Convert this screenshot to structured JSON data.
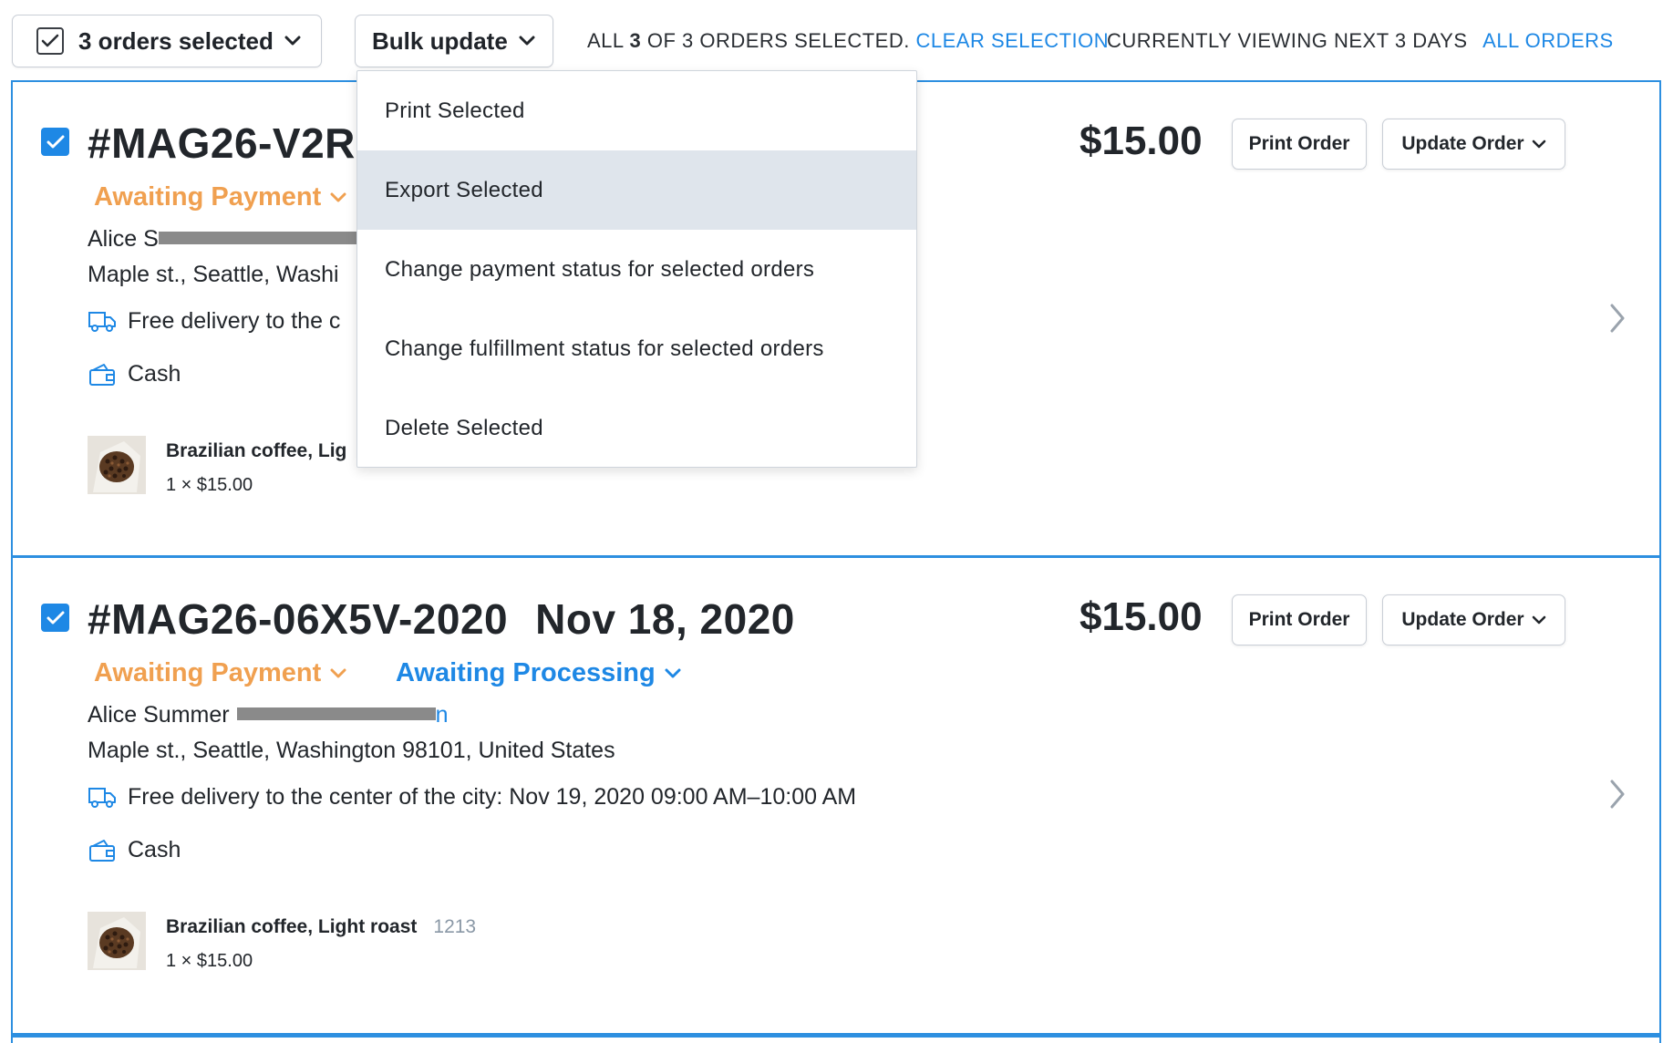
{
  "toolbar": {
    "selected_label": "3 orders selected",
    "bulk_label": "Bulk update",
    "sel_prefix": "ALL",
    "sel_count": "3",
    "sel_suffix": "OF 3 ORDERS SELECTED.",
    "clear_selection": "CLEAR SELECTION",
    "viewing": "CURRENTLY VIEWING NEXT 3 DAYS",
    "all_orders": "ALL ORDERS"
  },
  "dropdown": {
    "items": [
      {
        "label": "Print Selected"
      },
      {
        "label": "Export Selected"
      },
      {
        "label": "Change payment status for selected orders"
      },
      {
        "label": "Change fulfillment status for selected orders"
      },
      {
        "label": "Delete Selected"
      }
    ],
    "highlighted_index": 1
  },
  "orders": [
    {
      "number": "#MAG26-V2R",
      "date": "",
      "payment_status": "Awaiting Payment",
      "fulfillment_status": "",
      "customer": "Alice S",
      "email_tail": "",
      "address": "Maple st., Seattle, Washi",
      "delivery": "Free delivery to the c",
      "payment_method": "Cash",
      "product_name": "Brazilian coffee, Lig",
      "product_sku": "",
      "product_qty": "1 × $15.00",
      "price": "$15.00",
      "print_label": "Print Order",
      "update_label": "Update Order",
      "selected": true
    },
    {
      "number": "#MAG26-06X5V-2020",
      "date": "Nov 18, 2020",
      "payment_status": "Awaiting Payment",
      "fulfillment_status": "Awaiting Processing",
      "customer": "Alice Summer",
      "email_tail": "n",
      "address": "Maple st., Seattle, Washington 98101, United States",
      "delivery": "Free delivery to the center of the city: Nov 19, 2020 09:00 AM–10:00 AM",
      "payment_method": "Cash",
      "product_name": "Brazilian coffee, Light roast",
      "product_sku": "1213",
      "product_qty": "1 × $15.00",
      "price": "$15.00",
      "print_label": "Print Order",
      "update_label": "Update Order",
      "selected": true
    }
  ],
  "colors": {
    "accent": "#1e88e5",
    "payment_status": "#f0a050",
    "dropdown_highlight": "#dfe5ec"
  },
  "icons": {
    "checkmark": "check-icon",
    "chevron": "chevron-down-icon",
    "delivery": "truck-icon",
    "payment": "wallet-icon",
    "row_open": "chevron-right-icon"
  }
}
